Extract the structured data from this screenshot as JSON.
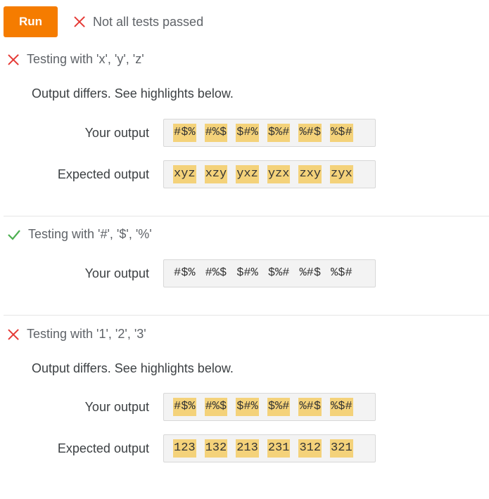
{
  "toolbar": {
    "run_label": "Run",
    "summary": "Not all tests passed",
    "summary_status": "fail"
  },
  "colors": {
    "run": "#f57c00",
    "fail": "#e53935",
    "pass": "#4caf50",
    "highlight": "#f4d27a"
  },
  "tests": [
    {
      "title": "Testing with 'x', 'y', 'z'",
      "status": "fail",
      "note": "Output differs. See highlights below.",
      "your_label": "Your output",
      "your_output": [
        "#$%",
        "#%$",
        "$#%",
        "$%#",
        "%#$",
        "%$#"
      ],
      "expected_label": "Expected output",
      "expected_output": [
        "xyz",
        "xzy",
        "yxz",
        "yzx",
        "zxy",
        "zyx"
      ]
    },
    {
      "title": "Testing with '#', '$', '%'",
      "status": "pass",
      "your_label": "Your output",
      "your_output": [
        "#$%",
        "#%$",
        "$#%",
        "$%#",
        "%#$",
        "%$#"
      ]
    },
    {
      "title": "Testing with '1', '2', '3'",
      "status": "fail",
      "note": "Output differs. See highlights below.",
      "your_label": "Your output",
      "your_output": [
        "#$%",
        "#%$",
        "$#%",
        "$%#",
        "%#$",
        "%$#"
      ],
      "expected_label": "Expected output",
      "expected_output": [
        "123",
        "132",
        "213",
        "231",
        "312",
        "321"
      ]
    }
  ]
}
